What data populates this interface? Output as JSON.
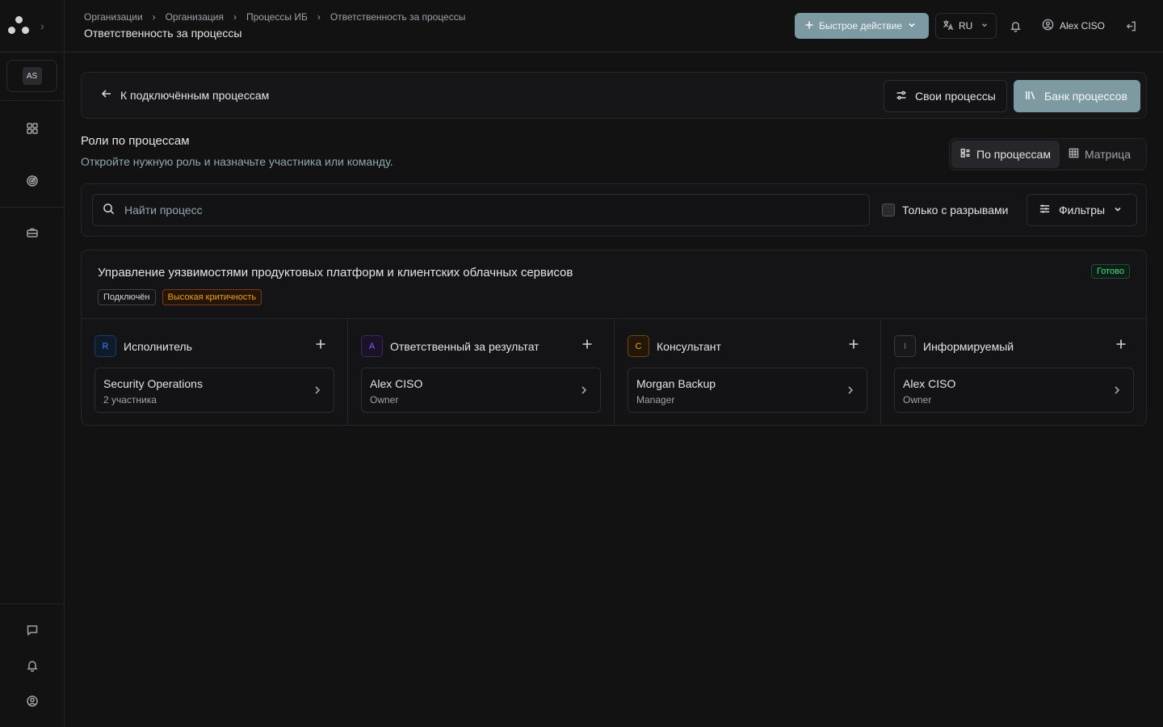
{
  "sidebar": {
    "avatar_initials": "AS",
    "nav_icons": [
      "dashboard-icon",
      "target-icon",
      "briefcase-icon"
    ],
    "bottom_icons": [
      "chat-icon",
      "bell-icon",
      "user-circle-icon"
    ]
  },
  "header": {
    "breadcrumb": [
      "Организации",
      "Организация",
      "Процессы ИБ",
      "Ответственность за процессы"
    ],
    "title": "Ответственность за процессы",
    "quick_action_label": "Быстрое действие",
    "language": "RU",
    "user_name": "Alex CISO"
  },
  "toolbar": {
    "back_label": "К подключённым процессам",
    "own_processes_label": "Свои процессы",
    "process_bank_label": "Банк процессов"
  },
  "section": {
    "title": "Роли по процессам",
    "subtitle": "Откройте нужную роль и назначьте участника или команду.",
    "view_by_process": "По процессам",
    "view_matrix": "Матрица"
  },
  "filters": {
    "search_placeholder": "Найти процесс",
    "only_gaps_label": "Только с разрывами",
    "only_gaps_checked": false,
    "filters_label": "Фильтры"
  },
  "process": {
    "title": "Управление уязвимостями продуктовых платформ и клиентских облачных сервисов",
    "status": "Готово",
    "tags": [
      "Подключён",
      "Высокая критичность"
    ],
    "roles": [
      {
        "letter": "R",
        "label": "Исполнитель",
        "accent": "#3b82f6",
        "assignee": "Security Operations",
        "detail": "2 участника"
      },
      {
        "letter": "A",
        "label": "Ответственный за результат",
        "accent": "#8b5cf6",
        "assignee": "Alex CISO",
        "detail": "Owner"
      },
      {
        "letter": "C",
        "label": "Консультант",
        "accent": "#f59e0b",
        "assignee": "Morgan Backup",
        "detail": "Manager"
      },
      {
        "letter": "I",
        "label": "Информируемый",
        "accent": "#71717a",
        "assignee": "Alex CISO",
        "detail": "Owner"
      }
    ]
  },
  "colors": {
    "accent": "#7d9aa2",
    "background": "#121212",
    "ready": "#4ade80",
    "critical": "#f59e0b"
  }
}
